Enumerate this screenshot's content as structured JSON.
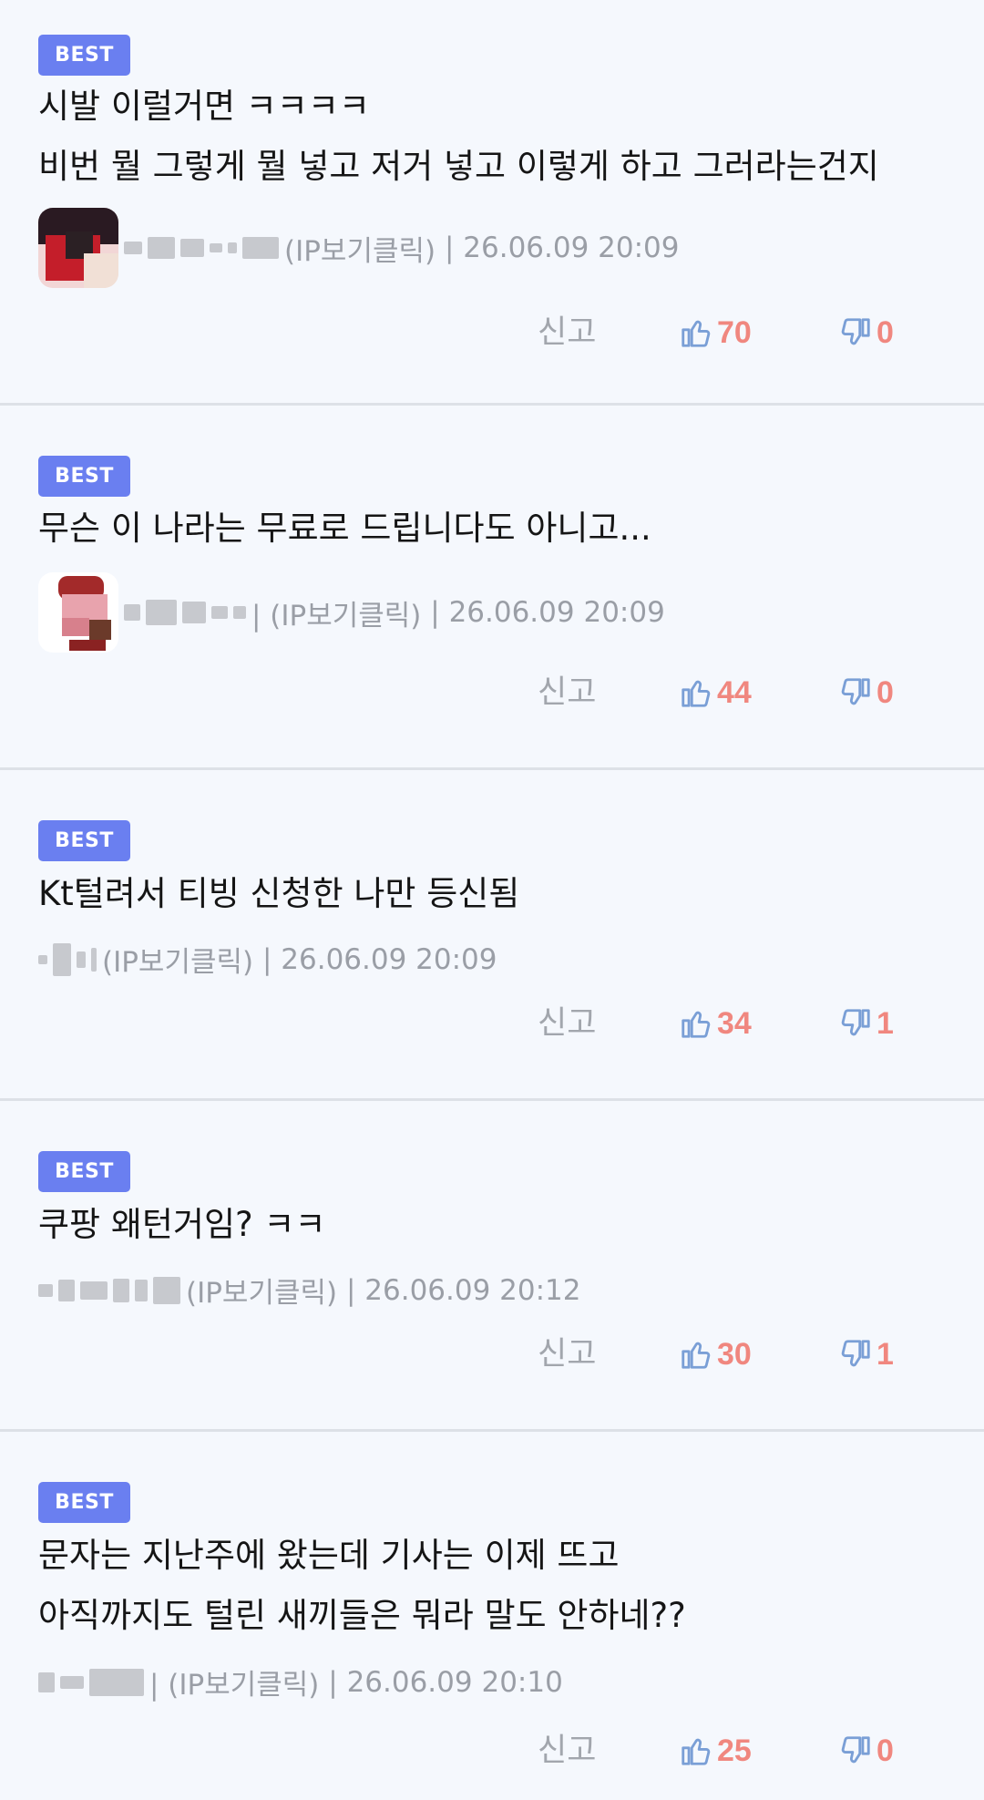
{
  "labels": {
    "best": "BEST",
    "report": "신고"
  },
  "colors": {
    "best_bg": "#6a7ff0",
    "count": "#f0877f",
    "thumb": "#7a9fd6",
    "meta": "#9a9ea6"
  },
  "comments": [
    {
      "lines": [
        "시발 이럴거면 ㅋㅋㅋㅋ",
        "비번 뭘 그렇게 뭘 넣고 저거 넣고 이렇게 하고 그러라는건지"
      ],
      "ip": "(IP보기클릭)",
      "time": "| 26.06.09 20:09",
      "likes": "70",
      "dislikes": "0"
    },
    {
      "lines": [
        "무슨 이 나라는 무료로 드립니다도 아니고..."
      ],
      "ip": "| (IP보기클릭)",
      "time": "| 26.06.09 20:09",
      "likes": "44",
      "dislikes": "0"
    },
    {
      "lines": [
        "Kt털려서 티빙 신청한 나만 등신됨"
      ],
      "ip": "(IP보기클릭)",
      "time": "| 26.06.09 20:09",
      "likes": "34",
      "dislikes": "1"
    },
    {
      "lines": [
        "쿠팡 왜턴거임? ㅋㅋ"
      ],
      "ip": "(IP보기클릭)",
      "time": "| 26.06.09 20:12",
      "likes": "30",
      "dislikes": "1"
    },
    {
      "lines": [
        "문자는 지난주에 왔는데 기사는 이제 뜨고",
        "아직까지도 털린 새끼들은 뭐라 말도 안하네??"
      ],
      "ip": "| (IP보기클릭)",
      "time": "| 26.06.09 20:10",
      "likes": "25",
      "dislikes": "0"
    }
  ]
}
